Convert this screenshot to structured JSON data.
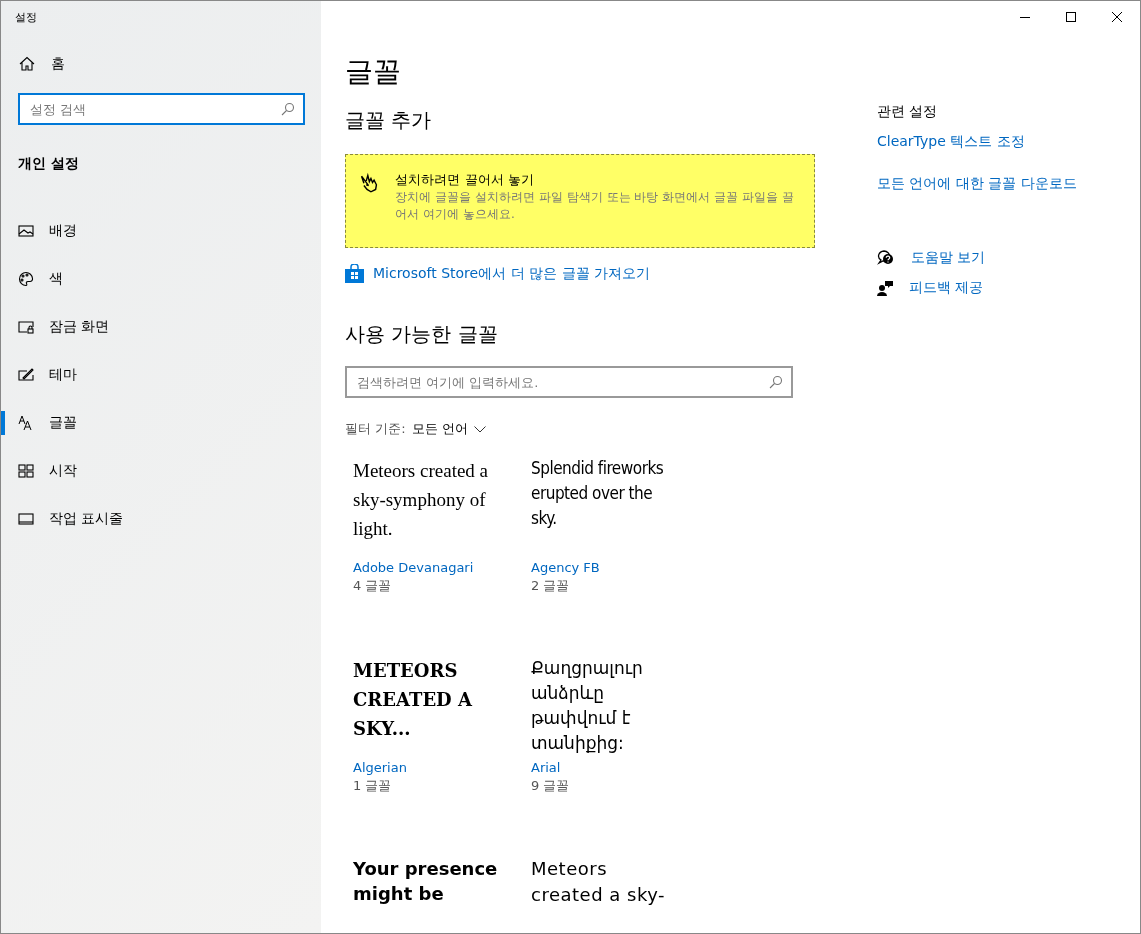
{
  "window": {
    "title": "설정"
  },
  "sidebar": {
    "home": "홈",
    "search": {
      "placeholder": "설정 검색"
    },
    "section": "개인 설정",
    "items": [
      {
        "label": "배경",
        "kind": "picture",
        "selected": false
      },
      {
        "label": "색",
        "kind": "palette",
        "selected": false
      },
      {
        "label": "잠금 화면",
        "kind": "lock",
        "selected": false
      },
      {
        "label": "테마",
        "kind": "theme",
        "selected": false
      },
      {
        "label": "글꼴",
        "kind": "font",
        "selected": true
      },
      {
        "label": "시작",
        "kind": "start",
        "selected": false
      },
      {
        "label": "작업 표시줄",
        "kind": "taskbar",
        "selected": false
      }
    ]
  },
  "page": {
    "title": "글꼴",
    "add_heading": "글꼴 추가",
    "drop_zone": {
      "title": "설치하려면 끌어서 놓기",
      "text": "장치에 글꼴을 설치하려면 파일 탐색기 또는 바탕 화면에서 글꼴 파일을 끌어서 여기에 놓으세요."
    },
    "store_link": "Microsoft Store에서 더 많은 글꼴 가져오기",
    "available_heading": "사용 가능한 글꼴",
    "font_search": {
      "placeholder": "검색하려면 여기에 입력하세요."
    },
    "filter": {
      "label": "필터 기준:",
      "value": "모든 언어"
    },
    "fonts": [
      {
        "preview": "Meteors created a sky-symphony of light.",
        "kind": "serif",
        "name": "Adobe Devanagari",
        "count": "4 글꼴"
      },
      {
        "preview": "Splendid fireworks erupted over the sky.",
        "kind": "condensed",
        "name": "Agency FB",
        "count": "2 글꼴"
      },
      {
        "preview": "METEORS CREATED A SKY...",
        "kind": "decorative",
        "name": "Algerian",
        "count": "1 글꼴"
      },
      {
        "preview": "Քաղցրալուր անձրևը թափվում է տանիքից:",
        "kind": "sans",
        "name": "Arial",
        "count": "9 글꼴"
      },
      {
        "preview": "Your presence might be",
        "kind": "bold"
      },
      {
        "preview": "Meteors created a sky-",
        "kind": "wide"
      }
    ]
  },
  "related": {
    "heading": "관련 설정",
    "links": [
      "ClearType 텍스트 조정",
      "모든 언어에 대한 글꼴 다운로드"
    ],
    "help": [
      {
        "label": "도움말 보기",
        "kind": "help"
      },
      {
        "label": "피드백 제공",
        "kind": "feedback"
      }
    ]
  }
}
